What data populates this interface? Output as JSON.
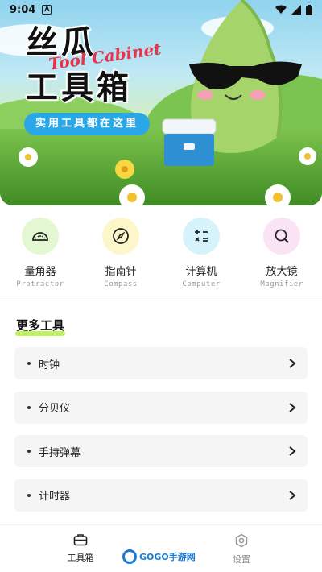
{
  "status_bar": {
    "time": "9:04",
    "badge": "A"
  },
  "banner": {
    "title_line1": "丝瓜",
    "title_line2": "工具箱",
    "script_text": "Tool Cabinet",
    "tagline": "实用工具都在这里"
  },
  "quick_tools": [
    {
      "name": "量角器",
      "en": "Protractor",
      "icon": "protractor-icon",
      "color": "#e3f8d2"
    },
    {
      "name": "指南针",
      "en": "Compass",
      "icon": "compass-icon",
      "color": "#fdf6c9"
    },
    {
      "name": "计算机",
      "en": "Computer",
      "icon": "calculator-icon",
      "color": "#d6f3fb"
    },
    {
      "name": "放大镜",
      "en": "Magnifier",
      "icon": "magnifier-icon",
      "color": "#fbe3f6"
    }
  ],
  "more_tools": {
    "title": "更多工具",
    "items": [
      {
        "label": "时钟"
      },
      {
        "label": "分贝仪"
      },
      {
        "label": "手持弹幕"
      },
      {
        "label": "计时器"
      }
    ]
  },
  "bottom_nav": [
    {
      "label": "工具箱",
      "icon": "toolbox-icon",
      "active": true
    },
    {
      "label": "设置",
      "icon": "settings-icon",
      "active": false
    }
  ],
  "watermark": {
    "text": "GOGO手游网"
  }
}
